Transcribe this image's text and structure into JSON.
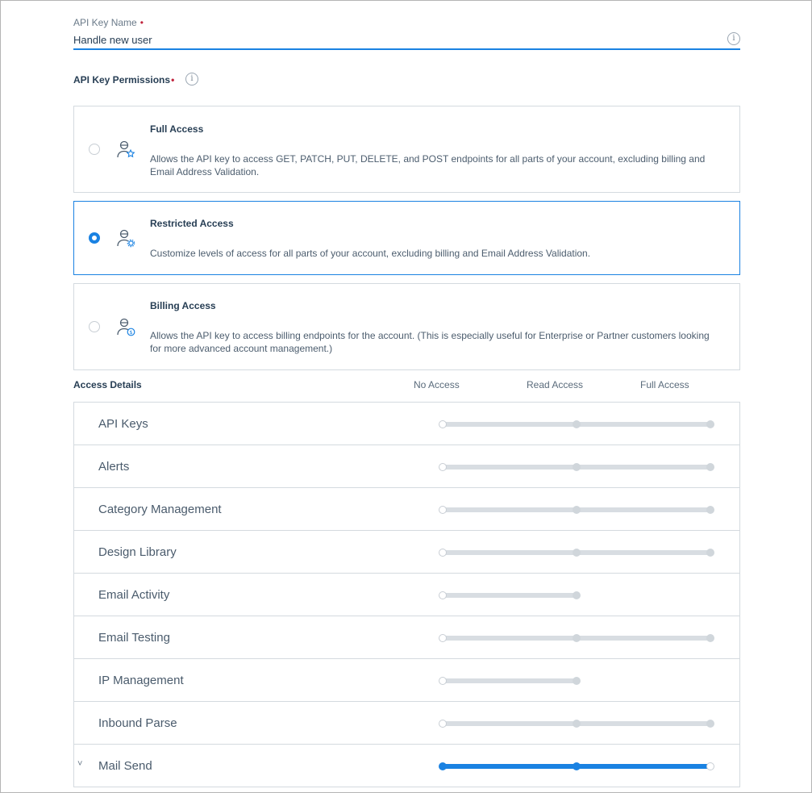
{
  "api_key_name": {
    "label": "API Key Name",
    "required_mark": "•",
    "value": "Handle new user",
    "info_icon": "info-icon"
  },
  "permissions": {
    "title": "API Key Permissions",
    "required_mark": "•",
    "info_icon": "info-icon",
    "options": [
      {
        "title": "Full Access",
        "description": "Allows the API key to access GET, PATCH, PUT, DELETE, and POST endpoints for all parts of your account, excluding billing and Email Address Validation.",
        "selected": false,
        "icon": "user-star-icon"
      },
      {
        "title": "Restricted Access",
        "description": "Customize levels of access for all parts of your account, excluding billing and Email Address Validation.",
        "selected": true,
        "icon": "user-gear-icon"
      },
      {
        "title": "Billing Access",
        "description": "Allows the API key to access billing endpoints for the account. (This is especially useful for Enterprise or Partner customers looking for more advanced account management.)",
        "selected": false,
        "icon": "user-dollar-icon"
      }
    ]
  },
  "access_details": {
    "title": "Access Details",
    "columns": [
      "No Access",
      "Read Access",
      "Full Access"
    ],
    "rows": [
      {
        "label": "API Keys",
        "levels": 3,
        "value": "No Access"
      },
      {
        "label": "Alerts",
        "levels": 3,
        "value": "No Access"
      },
      {
        "label": "Category Management",
        "levels": 3,
        "value": "No Access"
      },
      {
        "label": "Design Library",
        "levels": 3,
        "value": "No Access"
      },
      {
        "label": "Email Activity",
        "levels": 2,
        "value": "No Access"
      },
      {
        "label": "Email Testing",
        "levels": 3,
        "value": "No Access"
      },
      {
        "label": "IP Management",
        "levels": 2,
        "value": "No Access"
      },
      {
        "label": "Inbound Parse",
        "levels": 3,
        "value": "No Access"
      },
      {
        "label": "Mail Send",
        "levels": 3,
        "value": "Full Access",
        "expandable": true,
        "chevron_icon": "chevron-down-icon"
      }
    ]
  },
  "colors": {
    "accent": "#1a82e2",
    "required": "#c0233c",
    "track": "#d8dde2",
    "border": "#d4dadf"
  }
}
